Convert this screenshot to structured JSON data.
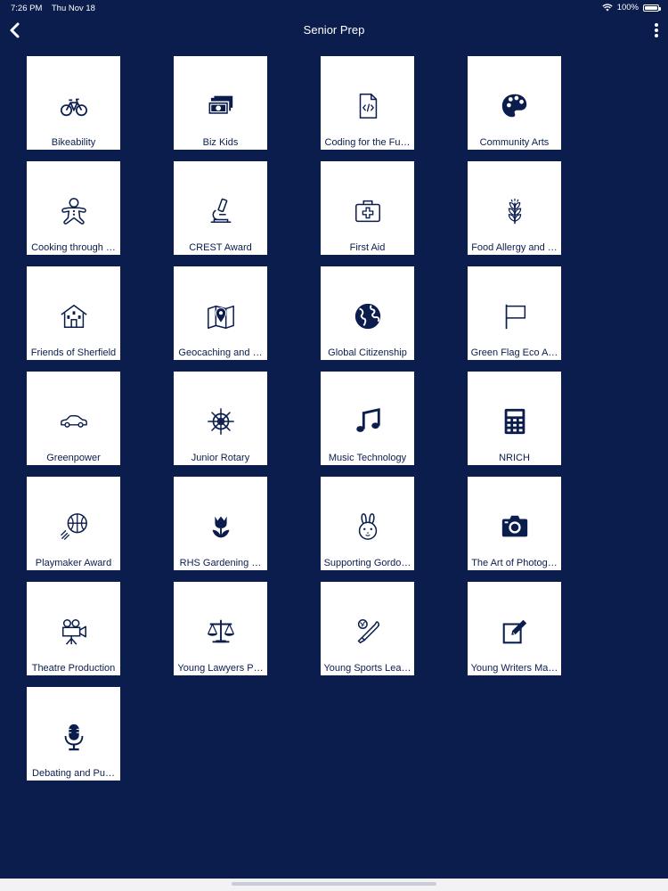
{
  "status": {
    "time": "7:26 PM",
    "date": "Thu Nov 18",
    "battery": "100%",
    "battery_level": 1.0
  },
  "nav": {
    "title": "Senior Prep"
  },
  "colors": {
    "background": "#0a1d4d",
    "tile": "#ffffff",
    "icon": "#0a1d4d"
  },
  "tiles": [
    {
      "label": "Bikeability",
      "icon": "bicycle-icon"
    },
    {
      "label": "Biz Kids",
      "icon": "money-stack-icon"
    },
    {
      "label": "Coding for the Fu…",
      "icon": "code-file-icon"
    },
    {
      "label": "Community Arts",
      "icon": "palette-icon"
    },
    {
      "label": "Cooking through …",
      "icon": "gingerbread-icon"
    },
    {
      "label": "CREST Award",
      "icon": "microscope-icon"
    },
    {
      "label": "First Aid",
      "icon": "first-aid-kit-icon"
    },
    {
      "label": "Food Allergy and …",
      "icon": "wheat-icon"
    },
    {
      "label": "Friends of Sherfield",
      "icon": "house-icon"
    },
    {
      "label": "Geocaching and …",
      "icon": "map-pin-icon"
    },
    {
      "label": "Global Citizenship",
      "icon": "globe-icon"
    },
    {
      "label": "Green Flag Eco A…",
      "icon": "flag-icon"
    },
    {
      "label": "Greenpower",
      "icon": "car-icon"
    },
    {
      "label": "Junior Rotary",
      "icon": "ship-wheel-icon"
    },
    {
      "label": "Music Technology",
      "icon": "music-note-icon"
    },
    {
      "label": "NRICH",
      "icon": "calculator-icon"
    },
    {
      "label": "Playmaker Award",
      "icon": "basketball-icon"
    },
    {
      "label": "RHS Gardening …",
      "icon": "tulip-icon"
    },
    {
      "label": "Supporting Gordo…",
      "icon": "rabbit-icon"
    },
    {
      "label": "The Art of Photog…",
      "icon": "camera-icon"
    },
    {
      "label": "Theatre Production",
      "icon": "movie-camera-icon"
    },
    {
      "label": "Young Lawyers P…",
      "icon": "scales-icon"
    },
    {
      "label": "Young Sports Lea…",
      "icon": "baseball-icon"
    },
    {
      "label": "Young Writers Ma…",
      "icon": "edit-icon"
    },
    {
      "label": "Debating and Pu…",
      "icon": "microphone-icon"
    }
  ]
}
